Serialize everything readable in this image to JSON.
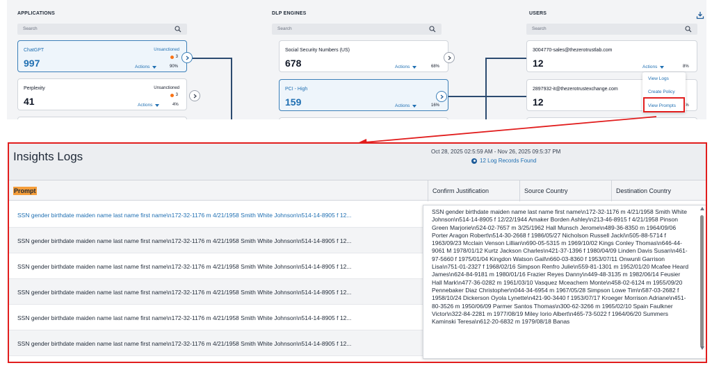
{
  "columns": {
    "applications": "APPLICATIONS",
    "dlp_engines": "DLP ENGINES",
    "users": "USERS"
  },
  "search_placeholder": "Search",
  "applications": [
    {
      "name": "ChatGPT",
      "count": "997",
      "status": "Unsanctioned",
      "badge": "3",
      "actions": "Actions",
      "percent": "90%"
    },
    {
      "name": "Perplexity",
      "count": "41",
      "status": "Unsanctioned",
      "badge": "3",
      "actions": "Actions",
      "percent": "4%"
    }
  ],
  "dlp_engines": [
    {
      "name": "Social Security Numbers (US)",
      "count": "678",
      "actions": "Actions",
      "percent": "68%"
    },
    {
      "name": "PCI - High",
      "count": "159",
      "actions": "Actions",
      "percent": "16%"
    }
  ],
  "users": [
    {
      "name": "3004770-sales@thezerotrustlab.com",
      "count": "12",
      "actions": "Actions",
      "percent": "8%"
    },
    {
      "name": "2897932-it@thezerotrustexchange.com",
      "count": "12",
      "percent": "8%"
    }
  ],
  "actions_menu": {
    "items": [
      "View Logs",
      "Create Policy",
      "View Prompts"
    ]
  },
  "insights": {
    "title": "Insights Logs",
    "date_range": "Oct 28, 2025 02:5:59 AM - Nov 26, 2025 09:5:37 PM",
    "records_found": "12 Log Records Found",
    "headers": [
      "Prompt",
      "Confirm Justification",
      "Source Country",
      "Destination Country"
    ],
    "rows": [
      "SSN gender birthdate maiden name last name first name\\n172-32-1176 m 4/21/1958 Smith White Johnson\\n514-14-8905 f 12...",
      "SSN gender birthdate maiden name last name first name\\n172-32-1176 m 4/21/1958 Smith White Johnson\\n514-14-8905 f 12...",
      "SSN gender birthdate maiden name last name first name\\n172-32-1176 m 4/21/1958 Smith White Johnson\\n514-14-8905 f 12...",
      "SSN gender birthdate maiden name last name first name\\n172-32-1176 m 4/21/1958 Smith White Johnson\\n514-14-8905 f 12...",
      "SSN gender birthdate maiden name last name first name\\n172-32-1176 m 4/21/1958 Smith White Johnson\\n514-14-8905 f 12...",
      "SSN gender birthdate maiden name last name first name\\n172-32-1176 m 4/21/1958 Smith White Johnson\\n514-14-8905 f 12..."
    ],
    "tooltip_text": "SSN gender birthdate maiden name last name first name\\n172-32-1176 m 4/21/1958 Smith White Johnson\\n514-14-8905 f 12/22/1944 Amaker Borden Ashley\\n213-46-8915 f 4/21/1958 Pinson Green Marjorie\\n524-02-7657 m 3/25/1962 Hall Munsch Jerome\\n489-36-8350 m 1964/09/06 Porter Aragon Robert\\n514-30-2668 f 1986/05/27 Nicholson Russell Jacki\\n505-88-5714 f 1963/09/23 Mcclain Venson Lillian\\n690-05-5315 m 1969/10/02 Kings Conley Thomas\\n646-44-9061 M 1978/01/12 Kurtz Jackson Charles\\n421-37-1396 f 1980/04/09 Linden Davis Susan\\n461-97-5660 f 1975/01/04 Kingdon Watson Gail\\n660-03-8360 f 1953/07/11 Onwunli Garrison Lisa\\n751-01-2327 f 1968/02/16 Simpson Renfro Julie\\n559-81-1301 m 1952/01/20 Mcafee Heard James\\n624-84-9181 m 1980/01/16 Frazier Reyes Danny\\n449-48-3135 m 1982/06/14 Feusier Hall Mark\\n477-36-0282 m 1961/03/10 Vasquez Mceachern Monte\\n458-02-6124 m 1955/09/20 Pennebaker Diaz Christopher\\n044-34-6954 m 1967/05/28 Simpson Lowe Tim\\n587-03-2682 f 1958/10/24 Dickerson Oyola Lynette\\n421-90-3440 f 1953/07/17 Kroeger Morrison Adriane\\n451-80-3526 m 1950/06/09 Parmer Santos Thomas\\n300-62-3266 m 1965/02/10 Spain Faulkner Victor\\n322-84-2281 m 1977/08/19 Miley Iorio Albert\\n465-73-5022 f 1964/06/20 Summers Kaminski Teresa\\n612-20-6832 m 1979/08/18 Banas"
  },
  "colors": {
    "accent": "#1f6fb2",
    "highlight_border": "#e11d1d",
    "prompt_highlight": "#f59e3b",
    "risk_dot": "#f97316"
  }
}
